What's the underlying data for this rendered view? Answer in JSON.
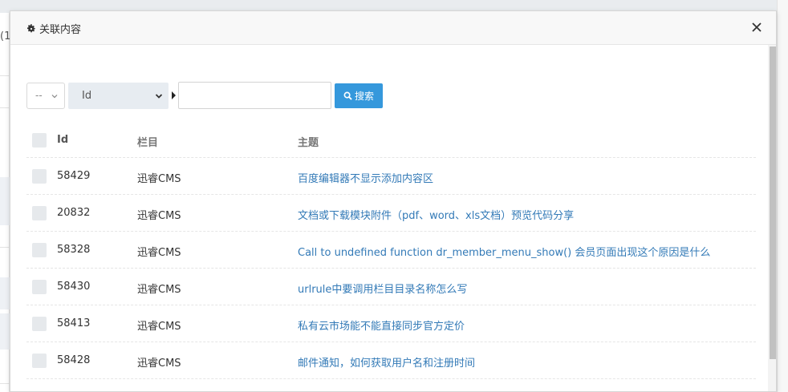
{
  "background": {
    "left_fragment": "(1"
  },
  "modal": {
    "title": "关联内容",
    "icons": {
      "title_icon": "gear-icon",
      "close": "close-icon"
    }
  },
  "filter": {
    "small_select_value": "--",
    "field_select_value": "Id",
    "search_value": "",
    "search_button_label": "搜索",
    "search_button_color": "#3598dc"
  },
  "table": {
    "headers": {
      "id": "Id",
      "category": "栏目",
      "title": "主题"
    },
    "rows": [
      {
        "id": "58429",
        "category": "迅睿CMS",
        "title": "百度编辑器不显示添加内容区"
      },
      {
        "id": "20832",
        "category": "迅睿CMS",
        "title": "文档或下载模块附件（pdf、word、xls文档）预览代码分享"
      },
      {
        "id": "58328",
        "category": "迅睿CMS",
        "title": "Call to undefined function dr_member_menu_show() 会员页面出现这个原因是什么"
      },
      {
        "id": "58430",
        "category": "迅睿CMS",
        "title": "urlrule中要调用栏目目录名称怎么写"
      },
      {
        "id": "58413",
        "category": "迅睿CMS",
        "title": "私有云市场能不能直接同步官方定价"
      },
      {
        "id": "58428",
        "category": "迅睿CMS",
        "title": "邮件通知，如何获取用户名和注册时间"
      }
    ]
  },
  "colors": {
    "link": "#337ab7",
    "primary": "#3598dc",
    "checkbox": "#e6e9ec"
  }
}
